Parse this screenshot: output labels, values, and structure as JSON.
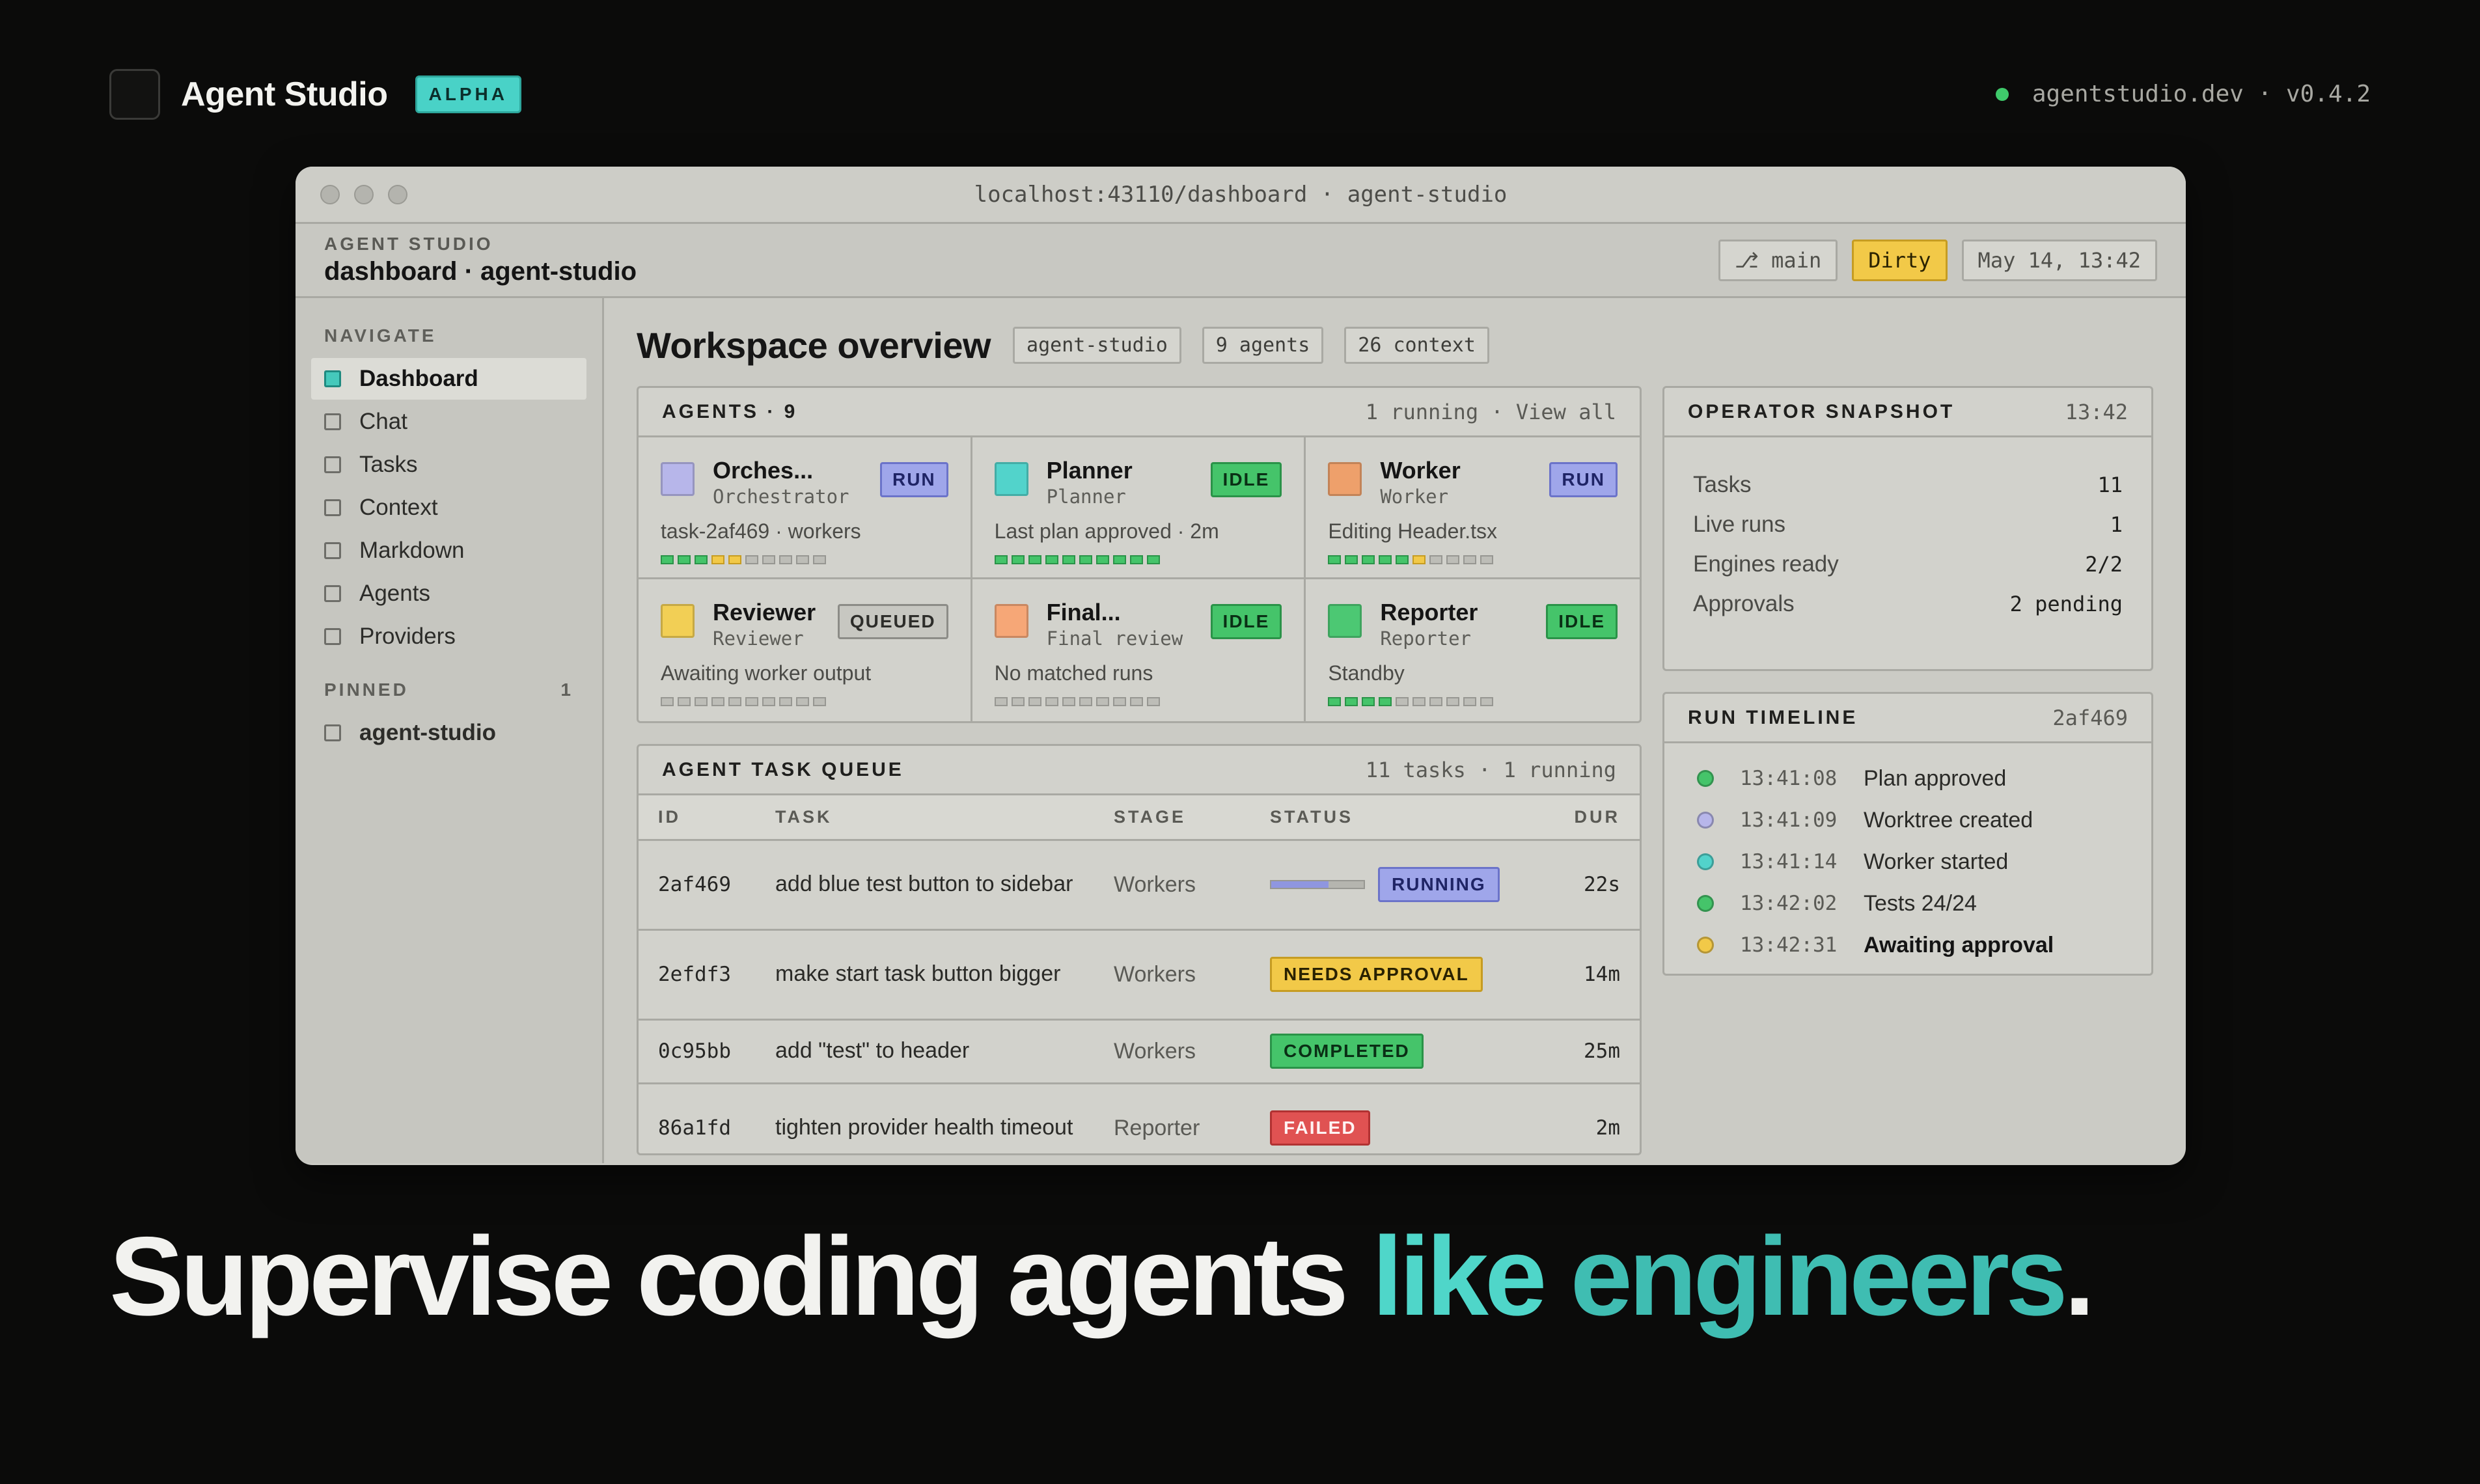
{
  "brand": {
    "name": "Agent Studio",
    "badge": "ALPHA",
    "site": "agentstudio.dev · v0.4.2",
    "status_color": "#3fca6b"
  },
  "window": {
    "url": "localhost:43110/dashboard · agent-studio"
  },
  "app_header": {
    "kicker": "AGENT STUDIO",
    "breadcrumb": "dashboard · agent-studio",
    "branch": "⎇ main",
    "state": "Dirty",
    "timestamp": "May 14, 13:42"
  },
  "sidebar": {
    "navigate_label": "NAVIGATE",
    "items": [
      {
        "label": "Dashboard",
        "active": true
      },
      {
        "label": "Chat"
      },
      {
        "label": "Tasks"
      },
      {
        "label": "Context"
      },
      {
        "label": "Markdown"
      },
      {
        "label": "Agents"
      },
      {
        "label": "Providers"
      }
    ],
    "pinned_label": "PINNED",
    "pinned_count": "1",
    "pinned_items": [
      {
        "label": "agent-studio"
      }
    ]
  },
  "workspace": {
    "title": "Workspace overview",
    "tags": [
      "agent-studio",
      "9 agents",
      "26 context"
    ]
  },
  "agents_panel": {
    "title": "AGENTS · 9",
    "meta": "1 running · View all",
    "agents": [
      {
        "name": "Orches...",
        "role": "Orchestrator",
        "badge": "RUN",
        "desc": "task-2af469 · workers",
        "color": "#b7b6ea",
        "progress": {
          "done": 3,
          "current": 2,
          "total": 10
        }
      },
      {
        "name": "Planner",
        "role": "Planner",
        "badge": "IDLE",
        "desc": "Last plan approved · 2m",
        "color": "#52d3cb",
        "progress": {
          "done": 10,
          "current": 0,
          "total": 10
        }
      },
      {
        "name": "Worker",
        "role": "Worker",
        "badge": "RUN",
        "desc": "Editing Header.tsx",
        "color": "#eea06b",
        "progress": {
          "done": 5,
          "current": 1,
          "total": 10
        }
      },
      {
        "name": "Reviewer",
        "role": "Reviewer",
        "badge": "QUEUED",
        "desc": "Awaiting worker output",
        "color": "#f2cf55",
        "progress": {
          "done": 0,
          "current": 0,
          "total": 10
        }
      },
      {
        "name": "Final...",
        "role": "Final review",
        "badge": "IDLE",
        "desc": "No matched runs",
        "color": "#f6a777",
        "progress": {
          "done": 0,
          "current": 0,
          "total": 10
        }
      },
      {
        "name": "Reporter",
        "role": "Reporter",
        "badge": "IDLE",
        "desc": "Standby",
        "color": "#4cc873",
        "progress": {
          "done": 4,
          "current": 0,
          "total": 10
        }
      }
    ]
  },
  "queue": {
    "title": "AGENT TASK QUEUE",
    "meta": "11 tasks · 1 running",
    "columns": [
      "ID",
      "TASK",
      "STAGE",
      "STATUS",
      "DUR"
    ],
    "rows": [
      {
        "id": "2af469",
        "task": "add blue test button to sidebar",
        "stage": "Workers",
        "status": "RUNNING",
        "progress": 0.62,
        "dur": "22s"
      },
      {
        "id": "2efdf3",
        "task": "make start task button bigger",
        "stage": "Workers",
        "status": "NEEDS APPROVAL",
        "dur": "14m"
      },
      {
        "id": "0c95bb",
        "task": "add \"test\" to header",
        "stage": "Workers",
        "status": "COMPLETED",
        "dur": "25m"
      },
      {
        "id": "86a1fd",
        "task": "tighten provider health timeout",
        "stage": "Reporter",
        "status": "FAILED",
        "dur": "2m"
      }
    ]
  },
  "snapshot": {
    "title": "OPERATOR SNAPSHOT",
    "time": "13:42",
    "rows": [
      {
        "label": "Tasks",
        "value": "11"
      },
      {
        "label": "Live runs",
        "value": "1"
      },
      {
        "label": "Engines ready",
        "value": "2/2"
      },
      {
        "label": "Approvals",
        "value": "2 pending"
      }
    ]
  },
  "timeline": {
    "title": "RUN TIMELINE",
    "run_id": "2af469",
    "events": [
      {
        "time": "13:41:08",
        "text": "Plan approved",
        "color": "#45c46a"
      },
      {
        "time": "13:41:09",
        "text": "Worktree created",
        "color": "#b7b6ea"
      },
      {
        "time": "13:41:14",
        "text": "Worker started",
        "color": "#52d3cb"
      },
      {
        "time": "13:42:02",
        "text": "Tests 24/24",
        "color": "#45c46a"
      },
      {
        "time": "13:42:31",
        "text": "Awaiting approval",
        "color": "#f2c948",
        "bold": true
      }
    ]
  },
  "headline": {
    "part1": "Supervise coding agents ",
    "part2": "like ",
    "part3": "engineers",
    "part4": "."
  }
}
